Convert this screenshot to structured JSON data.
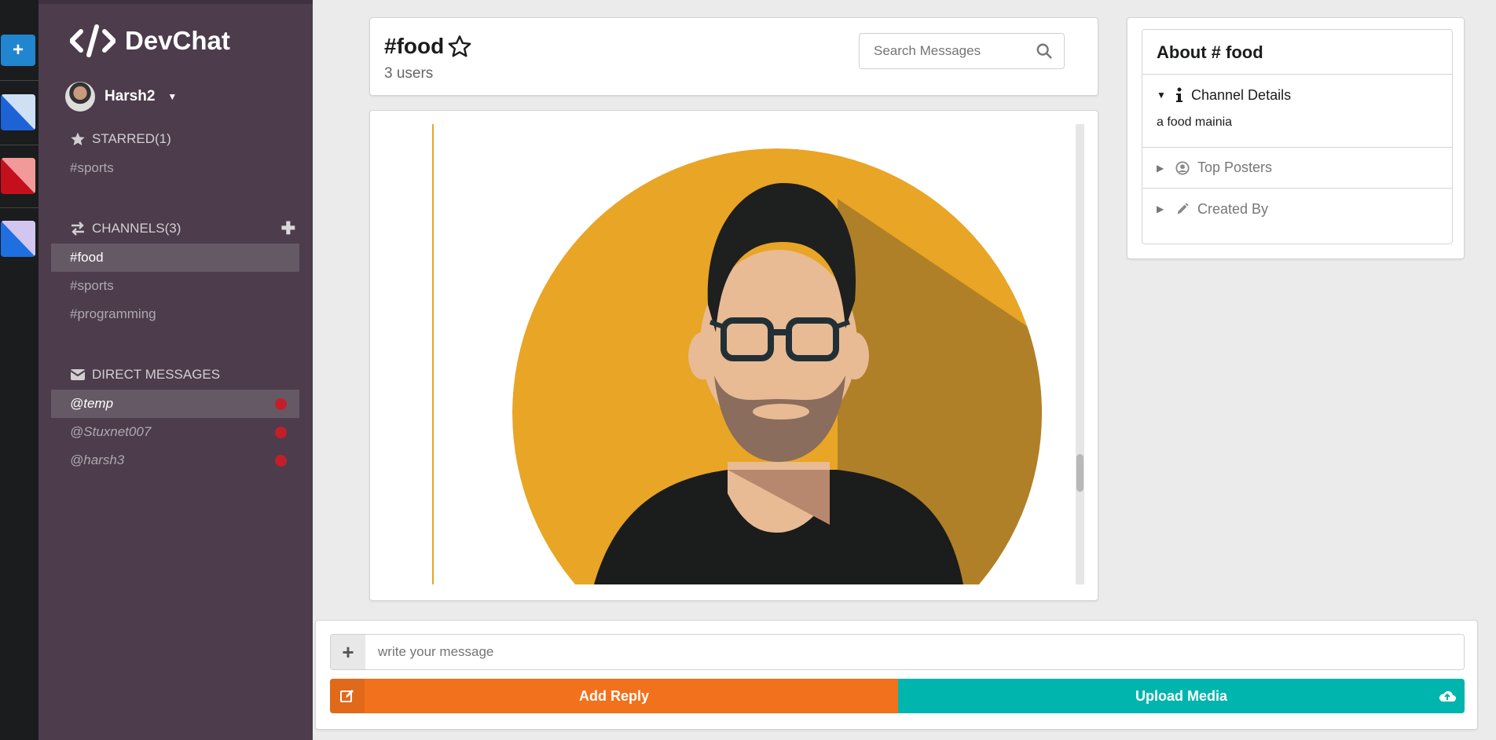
{
  "sidebar": {
    "app_name": "DevChat",
    "user": "Harsh2",
    "starred_header": "STARRED(1)",
    "starred": [
      "#sports"
    ],
    "channels_header": "CHANNELS(3)",
    "channels": [
      "#food",
      "#sports",
      "#programming"
    ],
    "dm_header": "DIRECT MESSAGES",
    "dms": [
      "@temp",
      "@Stuxnet007",
      "@harsh3"
    ]
  },
  "colors": {
    "sidebar": "#4c3c4c",
    "strip": "#1b1c1d",
    "reply": "#f2711c",
    "upload": "#00b5ad",
    "offline_dot": "#c21f2a",
    "avatar_bg": "#e8a526"
  },
  "header": {
    "channel_name": "#food",
    "users": "3 users",
    "search_placeholder": "Search Messages"
  },
  "about": {
    "title": "About # food",
    "details_label": "Channel Details",
    "description": "a food mainia",
    "top_posters": "Top Posters",
    "created_by": "Created By"
  },
  "form": {
    "placeholder": "write your message",
    "reply_label": "Add Reply",
    "upload_label": "Upload Media"
  },
  "icons": [
    "add-team-icon",
    "code-logo-icon",
    "star-icon",
    "exchange-icon",
    "plus-icon",
    "mail-icon",
    "search-icon",
    "info-icon",
    "user-circle-icon",
    "pencil-icon",
    "edit-icon",
    "cloud-upload-icon"
  ]
}
